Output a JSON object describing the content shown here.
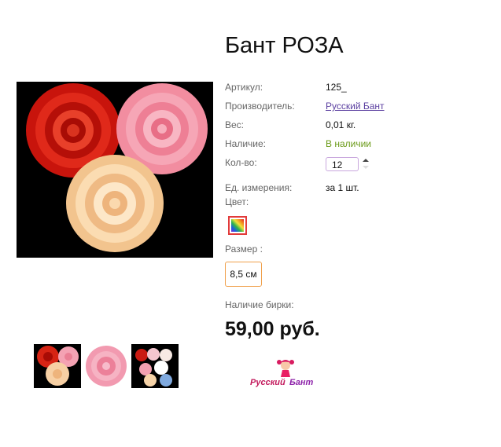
{
  "product": {
    "title": "Бант РОЗА",
    "price": "59,00 руб."
  },
  "properties": {
    "sku_label": "Артикул:",
    "sku_value": "125_",
    "maker_label": "Производитель:",
    "maker_value": "Русский Бант",
    "weight_label": "Вес:",
    "weight_value": "0,01 кг.",
    "stock_label": "Наличие:",
    "stock_value": "В наличии",
    "qty_label": "Кол-во:",
    "qty_value": "12",
    "unit_label": "Ед. измерения:",
    "unit_value": "за 1 шт.",
    "color_label": "Цвет:",
    "size_label": "Размер :",
    "size_value": "8,5 см",
    "tag_label": "Наличие бирки:"
  },
  "brand": {
    "logo_text_1": "Русский",
    "logo_text_2": "Бант"
  },
  "colors": {
    "stock_green": "#6a9a18",
    "link_purple": "#5b3fa0",
    "swatch_border": "#e23b3b",
    "size_border": "#f0a04a"
  },
  "icons": {
    "color_swatch": "rainbow-swatch-icon",
    "spinner": "spinner-arrows-icon"
  }
}
